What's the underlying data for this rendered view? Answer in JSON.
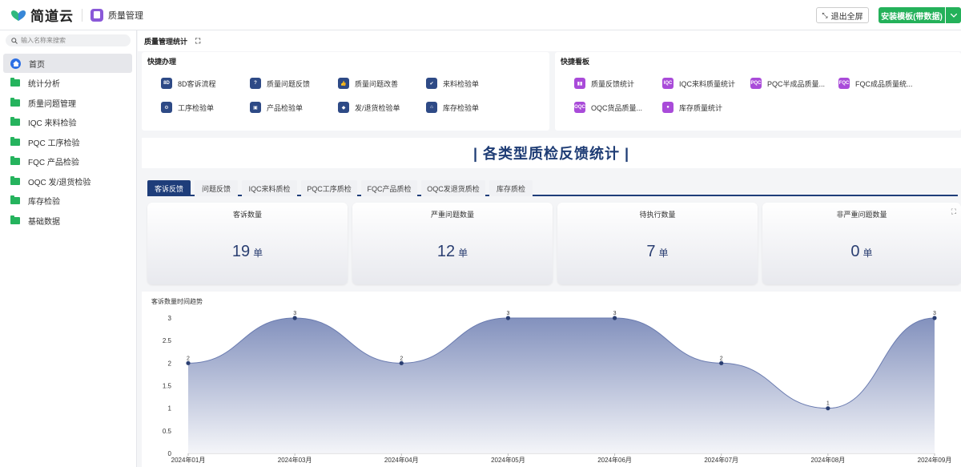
{
  "header": {
    "brand": "简道云",
    "app_name": "质量管理",
    "exit_fullscreen": "退出全屏",
    "install_template": "安装模板(带数据)"
  },
  "sidebar": {
    "search_placeholder": "输入名称来搜索",
    "items": [
      {
        "label": "首页",
        "icon": "home-icon"
      },
      {
        "label": "统计分析",
        "icon": "folder-icon"
      },
      {
        "label": "质量问题管理",
        "icon": "folder-icon"
      },
      {
        "label": "IQC 来料检验",
        "icon": "folder-icon"
      },
      {
        "label": "PQC 工序检验",
        "icon": "folder-icon"
      },
      {
        "label": "FQC 产品检验",
        "icon": "folder-icon"
      },
      {
        "label": "OQC 发/退货检验",
        "icon": "folder-icon"
      },
      {
        "label": "库存检验",
        "icon": "folder-icon"
      },
      {
        "label": "基础数据",
        "icon": "folder-icon"
      }
    ]
  },
  "page": {
    "title": "质量管理统计"
  },
  "quick_actions": {
    "title": "快捷办理",
    "items": [
      {
        "label": "8D客诉流程",
        "icon": "8D"
      },
      {
        "label": "质量问题反馈",
        "icon": "question-icon"
      },
      {
        "label": "质量问题改善",
        "icon": "thumbs-up-icon"
      },
      {
        "label": "来料检验单",
        "icon": "shield-check-icon"
      },
      {
        "label": "工序检验单",
        "icon": "gear-icon"
      },
      {
        "label": "产品检验单",
        "icon": "box-icon"
      },
      {
        "label": "发/退货检验单",
        "icon": "shield-icon"
      },
      {
        "label": "库存检验单",
        "icon": "warehouse-icon"
      }
    ]
  },
  "quick_boards": {
    "title": "快捷看板",
    "items": [
      {
        "label": "质量反馈统计",
        "icon": "bar-chart-icon"
      },
      {
        "label": "IQC来料质量统计",
        "icon": "IQC"
      },
      {
        "label": "PQC半成品质量...",
        "icon": "PQC"
      },
      {
        "label": "FQC成品质量统...",
        "icon": "FQC"
      },
      {
        "label": "OQC货品质量...",
        "icon": "OQC"
      },
      {
        "label": "库存质量统计",
        "icon": "circle-icon"
      }
    ]
  },
  "banner": {
    "text": "| 各类型质检反馈统计 |"
  },
  "tabs": [
    "客诉反馈",
    "问题反馈",
    "IQC来料质检",
    "PQC工序质检",
    "FQC产品质检",
    "OQC发退货质检",
    "库存质检"
  ],
  "active_tab": 0,
  "kpis": [
    {
      "label": "客诉数量",
      "value": "19",
      "unit": "单"
    },
    {
      "label": "严重问题数量",
      "value": "12",
      "unit": "单"
    },
    {
      "label": "待执行数量",
      "value": "7",
      "unit": "单"
    },
    {
      "label": "非严重问题数量",
      "value": "0",
      "unit": "单"
    }
  ],
  "colors": {
    "accent": "#1e3d7a",
    "install_green": "#24b15a",
    "folder_green": "#25b35d",
    "chart_line": "#6a7bb0"
  },
  "chart_data": {
    "type": "area",
    "title": "客诉数量时间趋势",
    "categories": [
      "2024年01月",
      "2024年03月",
      "2024年04月",
      "2024年05月",
      "2024年06月",
      "2024年07月",
      "2024年08月",
      "2024年09月"
    ],
    "values": [
      2,
      3,
      2,
      3,
      3,
      2,
      1,
      3
    ],
    "yticks": [
      "0",
      "0.5",
      "1",
      "1.5",
      "2",
      "2.5",
      "3"
    ],
    "ylim": [
      0,
      3
    ],
    "grid": false,
    "smooth": true
  }
}
